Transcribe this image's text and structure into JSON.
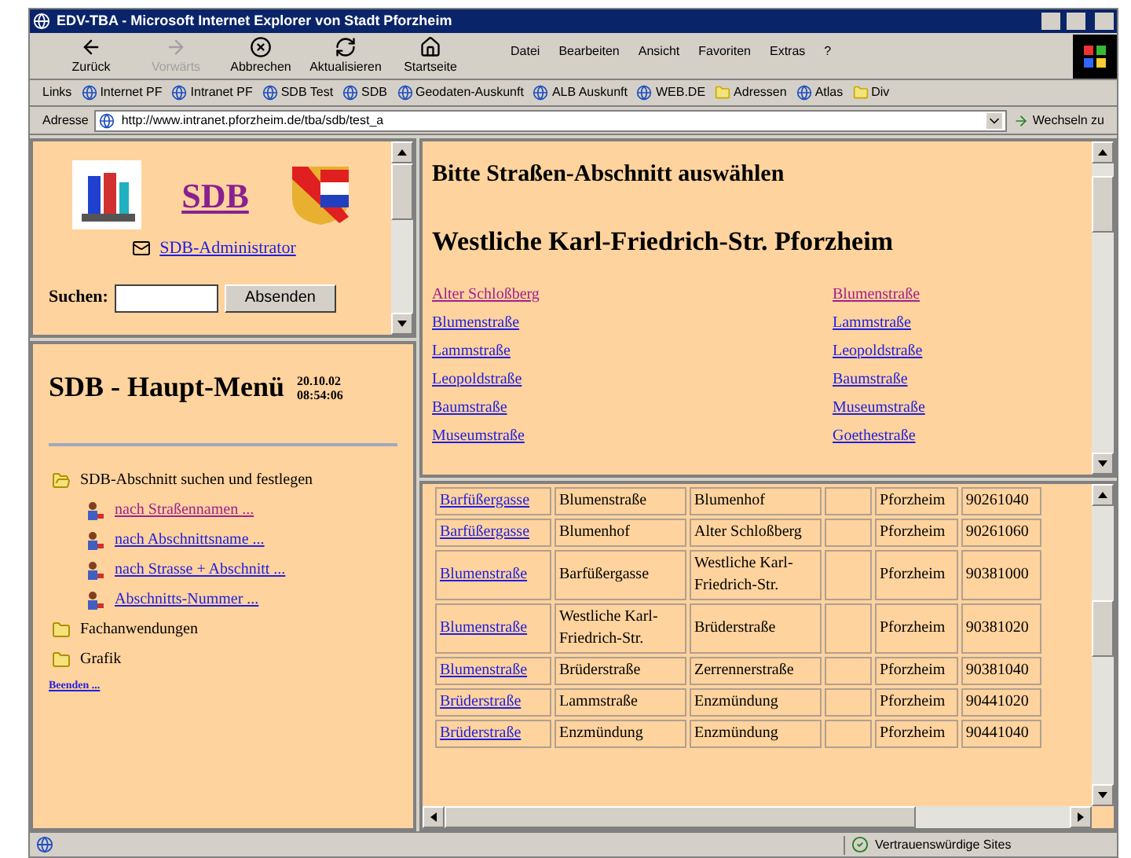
{
  "window": {
    "title": "EDV-TBA - Microsoft Internet Explorer von Stadt Pforzheim"
  },
  "toolbar": [
    {
      "label": "Zurück",
      "disabled": false
    },
    {
      "label": "Vorwärts",
      "disabled": true
    },
    {
      "label": "Abbrechen",
      "disabled": false
    },
    {
      "label": "Aktualisieren",
      "disabled": false
    },
    {
      "label": "Startseite",
      "disabled": false
    }
  ],
  "menu": [
    "Datei",
    "Bearbeiten",
    "Ansicht",
    "Favoriten",
    "Extras",
    "?"
  ],
  "links_bar": {
    "label": "Links",
    "items": [
      {
        "label": "Internet PF",
        "kind": "page"
      },
      {
        "label": "Intranet PF",
        "kind": "page"
      },
      {
        "label": "SDB Test",
        "kind": "page"
      },
      {
        "label": "SDB",
        "kind": "page"
      },
      {
        "label": "Geodaten-Auskunft",
        "kind": "page"
      },
      {
        "label": "ALB Auskunft",
        "kind": "page"
      },
      {
        "label": "WEB.DE",
        "kind": "page"
      },
      {
        "label": "Adressen",
        "kind": "folder"
      },
      {
        "label": "Atlas",
        "kind": "page"
      },
      {
        "label": "Div",
        "kind": "folder"
      }
    ]
  },
  "address": {
    "label": "Adresse",
    "value": "http://www.intranet.pforzheim.de/tba/sdb/test_a",
    "go": "Wechseln zu"
  },
  "header_frame": {
    "title": "SDB",
    "admin": "SDB-Administrator",
    "search_label": "Suchen:",
    "search_button": "Absenden"
  },
  "menu_frame": {
    "title": "SDB - Haupt-Menü",
    "date": "20.10.02",
    "time": "08:54:06",
    "tree": [
      {
        "label": "SDB-Abschnitt suchen und festlegen",
        "kind": "folder",
        "expanded": true,
        "children": [
          {
            "label": "nach Straßennamen ...",
            "visited": true
          },
          {
            "label": "nach Abschnittsname ...",
            "visited": false
          },
          {
            "label": "nach Strasse + Abschnitt ...",
            "visited": false
          },
          {
            "label": "Abschnitts-Nummer ...",
            "visited": false
          }
        ]
      },
      {
        "label": "Fachanwendungen",
        "kind": "folder",
        "expanded": false
      },
      {
        "label": "Grafik",
        "kind": "folder",
        "expanded": false
      }
    ],
    "exit_link": "Beenden ..."
  },
  "select_frame": {
    "heading": "Bitte Straßen-Abschnitt auswählen",
    "subheading": "Westliche Karl-Friedrich-Str. Pforzheim",
    "pairs": [
      {
        "from": {
          "label": "Alter Schloßberg",
          "visited": true
        },
        "to": {
          "label": "Blumenstraße",
          "visited": true
        }
      },
      {
        "from": {
          "label": "Blumenstraße",
          "visited": false
        },
        "to": {
          "label": "Lammstraße",
          "visited": false
        }
      },
      {
        "from": {
          "label": "Lammstraße",
          "visited": false
        },
        "to": {
          "label": "Leopoldstraße",
          "visited": false
        }
      },
      {
        "from": {
          "label": "Leopoldstraße",
          "visited": false
        },
        "to": {
          "label": "Baumstraße",
          "visited": false
        }
      },
      {
        "from": {
          "label": "Baumstraße",
          "visited": false
        },
        "to": {
          "label": "Museumstraße",
          "visited": false
        }
      },
      {
        "from": {
          "label": "Museumstraße",
          "visited": false
        },
        "to": {
          "label": "Goethestraße",
          "visited": false
        }
      }
    ]
  },
  "table": {
    "rows": [
      [
        "Barfüßergasse",
        "Blumenstraße",
        "Blumenhof",
        "",
        "Pforzheim",
        "90261040"
      ],
      [
        "Barfüßergasse",
        "Blumenhof",
        "Alter Schloßberg",
        "",
        "Pforzheim",
        "90261060"
      ],
      [
        "Blumenstraße",
        "Barfüßergasse",
        "Westliche Karl-Friedrich-Str.",
        "",
        "Pforzheim",
        "90381000"
      ],
      [
        "Blumenstraße",
        "Westliche Karl-Friedrich-Str.",
        "Brüderstraße",
        "",
        "Pforzheim",
        "90381020"
      ],
      [
        "Blumenstraße",
        "Brüderstraße",
        "Zerrennerstraße",
        "",
        "Pforzheim",
        "90381040"
      ],
      [
        "Brüderstraße",
        "Lammstraße",
        "Enzmündung",
        "",
        "Pforzheim",
        "90441020"
      ],
      [
        "Brüderstraße",
        "Enzmündung",
        "Enzmündung",
        "",
        "Pforzheim",
        "90441040"
      ]
    ]
  },
  "status_bar": {
    "zone": "Vertrauenswürdige Sites"
  }
}
